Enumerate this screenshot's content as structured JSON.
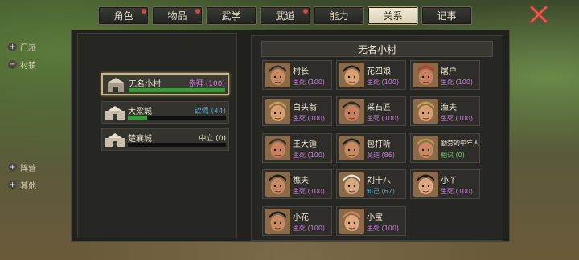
{
  "tabs": [
    {
      "label": "角色",
      "dot": true
    },
    {
      "label": "物品",
      "dot": true
    },
    {
      "label": "武学",
      "dot": false
    },
    {
      "label": "武道",
      "dot": true
    },
    {
      "label": "能力",
      "dot": false
    },
    {
      "label": "关系",
      "dot": false,
      "active": true
    },
    {
      "label": "记事",
      "dot": false
    }
  ],
  "tree": {
    "categories": [
      {
        "sign": "+",
        "label": "门派"
      },
      {
        "sign": "−",
        "label": "村镇"
      },
      {
        "sign": "+",
        "label": "阵营"
      },
      {
        "sign": "+",
        "label": "其他"
      }
    ],
    "towns": [
      {
        "name": "无名小村",
        "relation": "崇拜 (100)",
        "color": "#c880d8",
        "progress": 1.0,
        "selected": true
      },
      {
        "name": "大梁城",
        "relation": "钦佩 (44)",
        "color": "#4aa8d0",
        "progress": 0.2
      },
      {
        "name": "楚襄城",
        "relation": "中立 (0)",
        "color": "#e8e0c8",
        "progress": 0.0
      }
    ]
  },
  "grid": {
    "title": "无名小村",
    "npcs": [
      {
        "name": "村长",
        "status": "生死 (100)",
        "color": "#c880d8",
        "face": "elder-hat"
      },
      {
        "name": "花四娘",
        "status": "生死 (100)",
        "color": "#c880d8",
        "face": "woman"
      },
      {
        "name": "屠户",
        "status": "生死 (100)",
        "color": "#c880d8",
        "face": "red-headband"
      },
      {
        "name": "白头翁",
        "status": "生死 (100)",
        "color": "#c880d8",
        "face": "old-straw-hat"
      },
      {
        "name": "采石匠",
        "status": "生死 (100)",
        "color": "#c880d8",
        "face": "red-shirt"
      },
      {
        "name": "渔夫",
        "status": "生死 (100)",
        "color": "#c880d8",
        "face": "straw-hat"
      },
      {
        "name": "王大锤",
        "status": "生死 (100)",
        "color": "#c880d8",
        "face": "bald"
      },
      {
        "name": "包打听",
        "status": "莫逆 (86)",
        "color": "#c880d8",
        "face": "plain"
      },
      {
        "name": "勤劳的中年人",
        "status": "相识 (0)",
        "color": "#6ad06a",
        "face": "straw-hat-farmer"
      },
      {
        "name": "樵夫",
        "status": "生死 (100)",
        "color": "#c880d8",
        "face": "plain"
      },
      {
        "name": "刘十八",
        "status": "知己 (67)",
        "color": "#4aa8d0",
        "face": "white-hair"
      },
      {
        "name": "小丫",
        "status": "生死 (100)",
        "color": "#c880d8",
        "face": "girl"
      },
      {
        "name": "小花",
        "status": "生死 (100)",
        "color": "#c880d8",
        "face": "plain"
      },
      {
        "name": "小宝",
        "status": "生死 (100)",
        "color": "#c880d8",
        "face": "bald-kid"
      }
    ]
  }
}
